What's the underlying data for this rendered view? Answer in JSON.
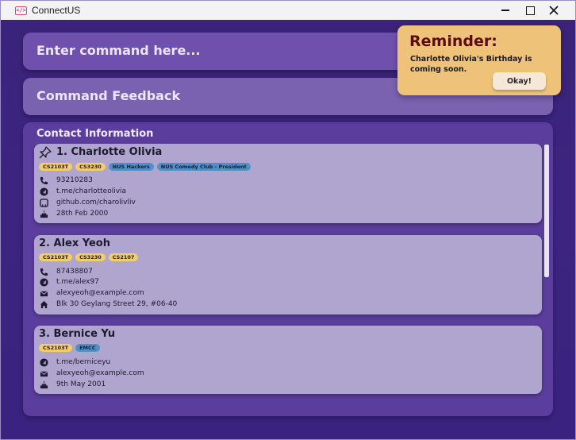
{
  "window": {
    "title": "ConnectUS",
    "icon": "code-brackets-icon",
    "controls": [
      "minimize-icon",
      "maximize-icon",
      "close-icon"
    ]
  },
  "command": {
    "placeholder": "Enter command here..."
  },
  "feedback": {
    "text": "Command Feedback"
  },
  "contacts": {
    "title": "Contact Information",
    "list": [
      {
        "name": "1. Charlotte Olivia",
        "pinned": true,
        "tags": [
          {
            "label": "CS2103T",
            "color": "#f2cd6a"
          },
          {
            "label": "CS3230",
            "color": "#f2cd6a"
          },
          {
            "label": "NUS Hackers",
            "color": "#4f91c5"
          },
          {
            "label": "NUS Comedy Club - President",
            "color": "#4f91c5"
          }
        ],
        "details": [
          {
            "icon": "phone-icon",
            "value": "93210283"
          },
          {
            "icon": "telegram-icon",
            "value": "t.me/charlotteolivia"
          },
          {
            "icon": "github-icon",
            "value": "github.com/charolivliv"
          },
          {
            "icon": "birthday-cake-icon",
            "value": "28th Feb 2000"
          }
        ]
      },
      {
        "name": "2. Alex Yeoh",
        "pinned": false,
        "tags": [
          {
            "label": "CS2103T",
            "color": "#f2cd6a"
          },
          {
            "label": "CS3230",
            "color": "#f2cd6a"
          },
          {
            "label": "CS2107",
            "color": "#f2cd6a"
          }
        ],
        "details": [
          {
            "icon": "phone-icon",
            "value": "87438807"
          },
          {
            "icon": "telegram-icon",
            "value": "t.me/alex97"
          },
          {
            "icon": "email-icon",
            "value": "alexyeoh@example.com"
          },
          {
            "icon": "home-icon",
            "value": "Blk 30 Geylang Street 29, #06-40"
          }
        ]
      },
      {
        "name": "3. Bernice Yu",
        "pinned": false,
        "tags": [
          {
            "label": "CS2103T",
            "color": "#f2cd6a"
          },
          {
            "label": "EMCC",
            "color": "#4f91c5"
          }
        ],
        "details": [
          {
            "icon": "telegram-icon",
            "value": "t.me/berniceyu"
          },
          {
            "icon": "email-icon",
            "value": "alexyeoh@example.com"
          },
          {
            "icon": "birthday-cake-icon",
            "value": "9th May 2001"
          }
        ]
      }
    ]
  },
  "reminder": {
    "title": "Reminder:",
    "message": "Charlotte Olivia's Birthday is coming soon.",
    "button": "Okay!"
  }
}
